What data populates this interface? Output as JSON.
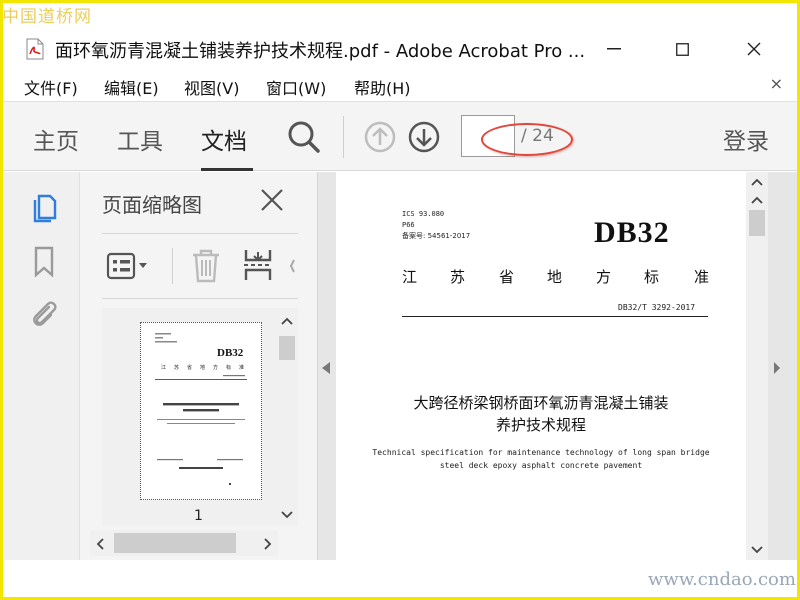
{
  "watermark": {
    "top": "中国道桥网",
    "bottom": "www.cndao.com"
  },
  "window": {
    "title": "面环氧沥青混凝土铺装养护技术规程.pdf - Adobe Acrobat Pro ...",
    "icon": "pdf-file-icon",
    "controls": {
      "minimize": "—",
      "maximize": "☐",
      "close": "✕"
    }
  },
  "menu": {
    "items": [
      {
        "label": "文件(F)"
      },
      {
        "label": "编辑(E)"
      },
      {
        "label": "视图(V)"
      },
      {
        "label": "窗口(W)"
      },
      {
        "label": "帮助(H)"
      }
    ],
    "close": "×"
  },
  "toolbar": {
    "tabs": [
      {
        "label": "主页"
      },
      {
        "label": "工具"
      },
      {
        "label": "文档",
        "active": true
      }
    ],
    "search_icon": "search-icon",
    "prev_page_icon": "arrow-up-circle-icon",
    "next_page_icon": "arrow-down-circle-icon",
    "current_page": "",
    "page_total": "/ 24",
    "login": "登录",
    "annotation_color": "#e0463a"
  },
  "sidebar_rail": {
    "icons": [
      "page-thumbnails-icon",
      "bookmark-icon",
      "attachment-paperclip-icon"
    ],
    "accent": "#2e7de1"
  },
  "thumbnail_panel": {
    "title": "页面缩略图",
    "close_icon": "close-icon",
    "tools": [
      "options-menu-icon",
      "delete-trash-icon",
      "extract-pages-icon"
    ],
    "thumbnail_page_label": "1"
  },
  "document": {
    "header_lines": [
      "ICS 93.080",
      "P66",
      "备案号: 54561-2017"
    ],
    "logo": "DB32",
    "standard_words": [
      "江",
      "苏",
      "省",
      "地",
      "方",
      "标",
      "准"
    ],
    "code": "DB32/T 3292-2017",
    "title_cn": [
      "大跨径桥梁钢桥面环氧沥青混凝土铺装",
      "养护技术规程"
    ],
    "title_en": [
      "Technical specification for maintenance technology of long span bridge",
      "steel deck epoxy asphalt concrete pavement"
    ]
  }
}
